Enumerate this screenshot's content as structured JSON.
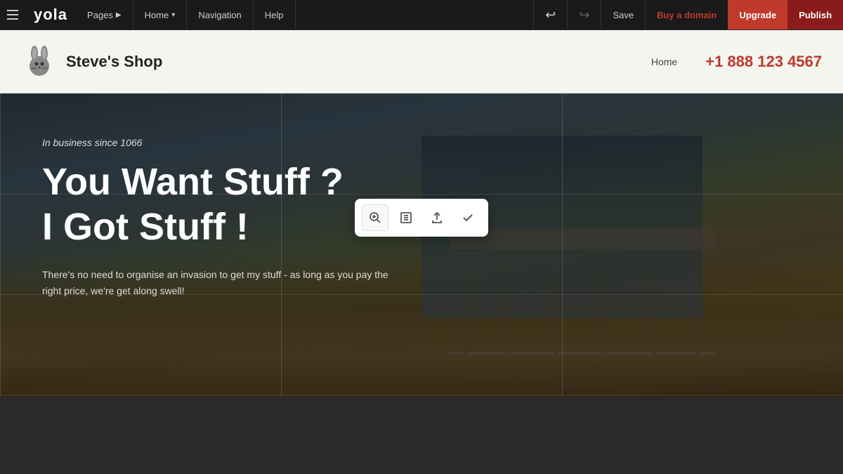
{
  "topnav": {
    "logo": "yola",
    "pages_label": "Pages",
    "home_label": "Home",
    "navigation_label": "Navigation",
    "help_label": "Help",
    "undo_symbol": "↩",
    "redo_symbol": "↪",
    "save_label": "Save",
    "buy_domain_label": "Buy a domain",
    "upgrade_label": "Upgrade",
    "publish_label": "Publish"
  },
  "site_header": {
    "site_name": "Steve's Shop",
    "nav_home": "Home",
    "phone": "+1 888 123 4567"
  },
  "hero": {
    "subtitle": "In business since 1066",
    "title_line1": "You Want Stuff ?",
    "title_line2": "I Got Stuff !",
    "description": "There's no need to organise an invasion to get my stuff - as long as\nyou pay the right price, we're get along swell!"
  },
  "toolbar": {
    "zoom_icon": "⊕",
    "crop_icon": "⊡",
    "share_icon": "⬆",
    "check_icon": "✓"
  },
  "colors": {
    "publish_bg": "#8b1a1a",
    "upgrade_bg": "#c0392b",
    "buy_domain_color": "#c0392b",
    "phone_color": "#c0392b"
  }
}
